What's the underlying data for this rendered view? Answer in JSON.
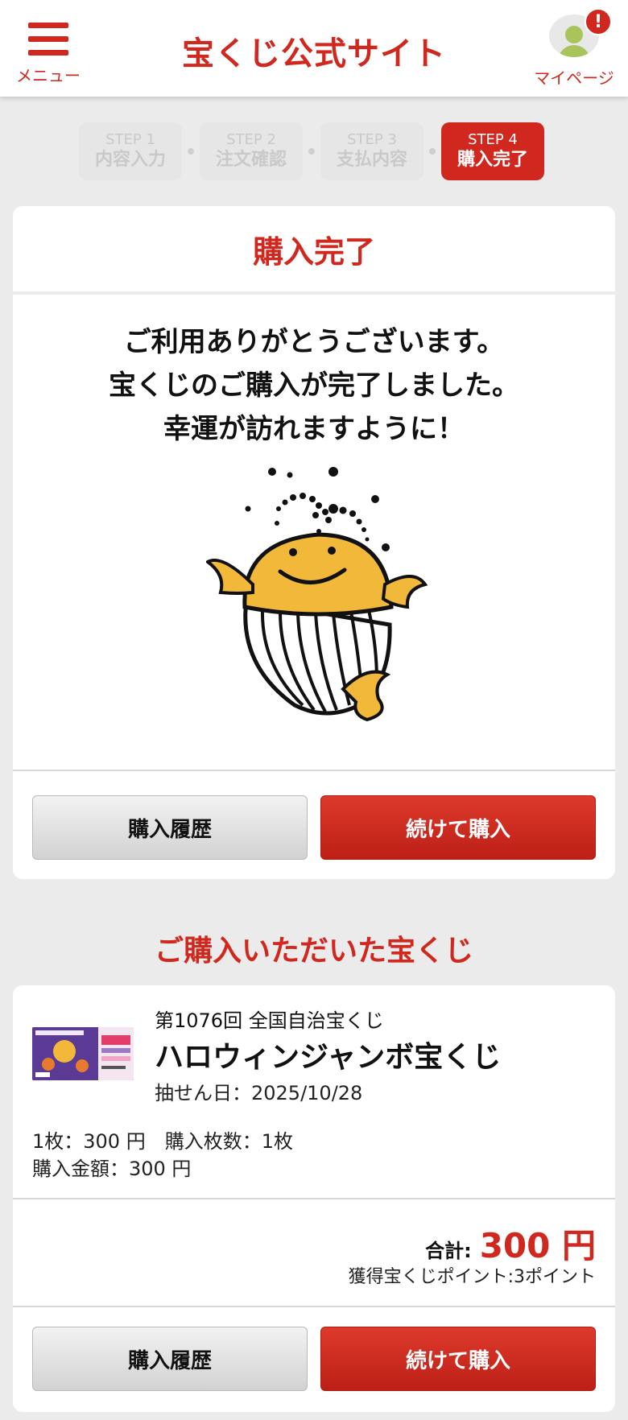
{
  "header": {
    "menu_label": "メニュー",
    "site_title": "宝くじ公式サイト",
    "mypage_label": "マイページ",
    "notification_badge": "!"
  },
  "steps": [
    {
      "num": "STEP 1",
      "name": "内容入力",
      "active": false
    },
    {
      "num": "STEP 2",
      "name": "注文確認",
      "active": false
    },
    {
      "num": "STEP 3",
      "name": "支払内容",
      "active": false
    },
    {
      "num": "STEP 4",
      "name": "購入完了",
      "active": true
    }
  ],
  "complete": {
    "title": "購入完了",
    "message_lines": [
      "ご利用ありがとうございます。",
      "宝くじのご購入が完了しました。",
      "幸運が訪れますように！"
    ],
    "history_button": "購入履歴",
    "continue_button": "続けて購入"
  },
  "purchased": {
    "section_title": "ご購入いただいた宝くじ",
    "round": "第1076回 全国自治宝くじ",
    "name": "ハロウィンジャンボ宝くじ",
    "draw_date": "抽せん日：2025/10/28",
    "unit_and_count": "1枚：300 円　購入枚数：1枚",
    "amount": "購入金額：300 円",
    "total_label": "合計:",
    "total_value": "300 円",
    "points": "獲得宝くじポイント:3ポイント",
    "history_button": "購入履歴",
    "continue_button": "続けて購入"
  },
  "colors": {
    "accent": "#d0281f",
    "background": "#ebebeb",
    "mascot_yellow": "#f2b83a"
  },
  "icons": {
    "menu": "hamburger-icon",
    "avatar": "user-avatar-icon",
    "mascot": "whale-mascot"
  }
}
